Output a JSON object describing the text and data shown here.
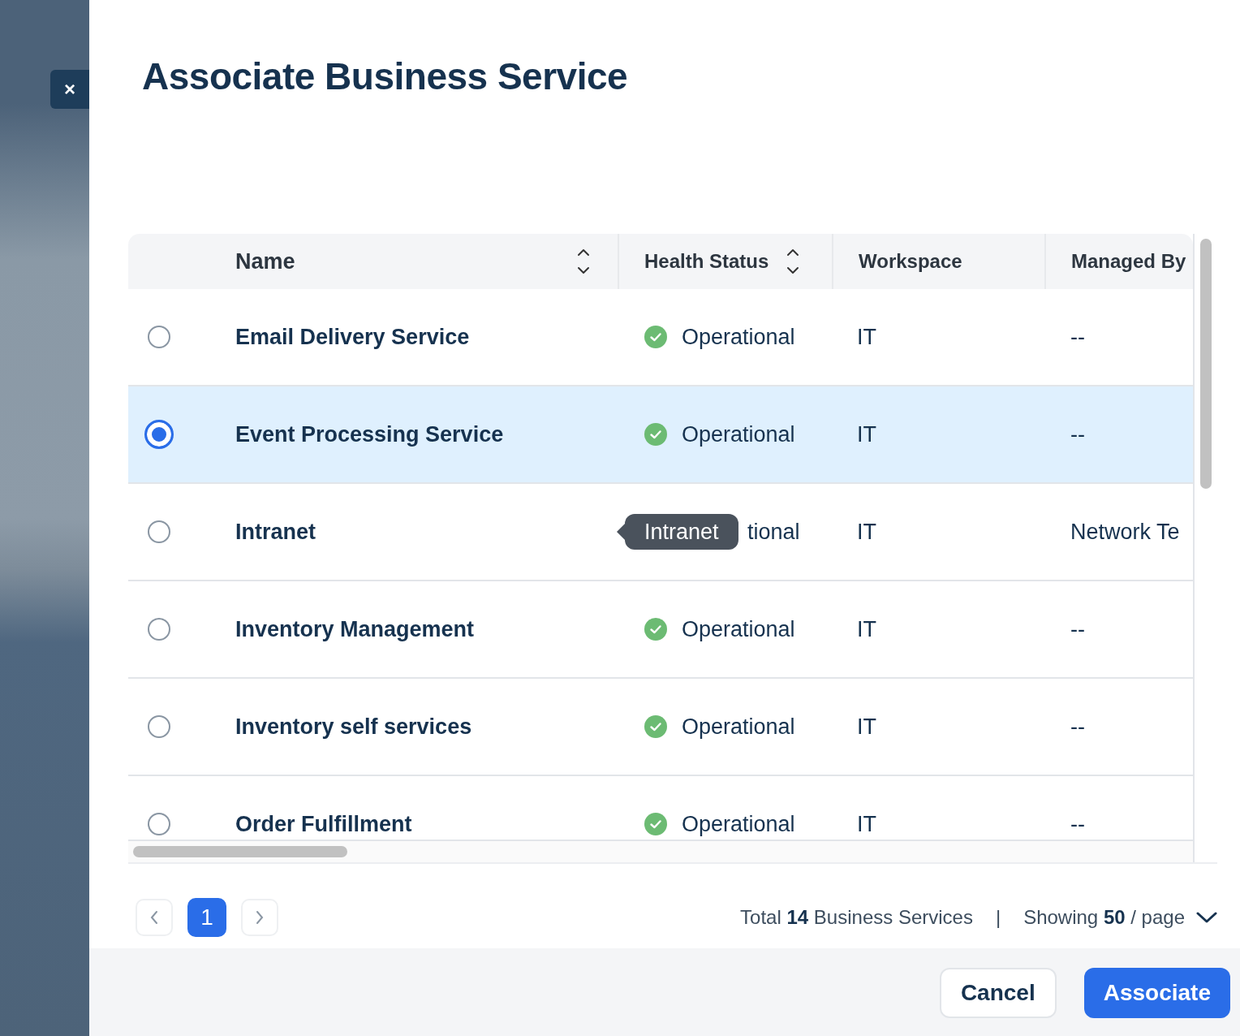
{
  "dialog": {
    "close_label": "×",
    "title": "Associate Business Service"
  },
  "table": {
    "columns": [
      {
        "label": "Name",
        "sortable": true
      },
      {
        "label": "Health Status",
        "sortable": true
      },
      {
        "label": "Workspace",
        "sortable": false
      },
      {
        "label": "Managed By",
        "sortable": false
      }
    ],
    "rows": [
      {
        "selected": false,
        "name": "Email Delivery Service",
        "health": {
          "kind": "operational",
          "text": "Operational"
        },
        "workspace": "IT",
        "managed_by": "--"
      },
      {
        "selected": true,
        "name": "Event Processing Service",
        "health": {
          "kind": "operational",
          "text": "Operational"
        },
        "workspace": "IT",
        "managed_by": "--"
      },
      {
        "selected": false,
        "name": "Intranet",
        "health": {
          "kind": "covered",
          "text": "tional"
        },
        "workspace": "IT",
        "managed_by": "Network Te",
        "tooltip": "Intranet"
      },
      {
        "selected": false,
        "name": "Inventory Management",
        "health": {
          "kind": "operational",
          "text": "Operational"
        },
        "workspace": "IT",
        "managed_by": "--"
      },
      {
        "selected": false,
        "name": "Inventory self services",
        "health": {
          "kind": "operational",
          "text": "Operational"
        },
        "workspace": "IT",
        "managed_by": "--"
      },
      {
        "selected": false,
        "name": "Order Fulfillment",
        "health": {
          "kind": "operational",
          "text": "Operational"
        },
        "workspace": "IT",
        "managed_by": "--"
      }
    ]
  },
  "pagination": {
    "pages": [
      {
        "label": "1",
        "selected": true
      }
    ],
    "total": "Total **14** Business Services",
    "separator": "|",
    "page_size": "Showing **50** / page"
  },
  "buttons": [
    {
      "label": "Cancel",
      "kind": "secondary"
    },
    {
      "label": "Associate",
      "kind": "primary"
    }
  ]
}
